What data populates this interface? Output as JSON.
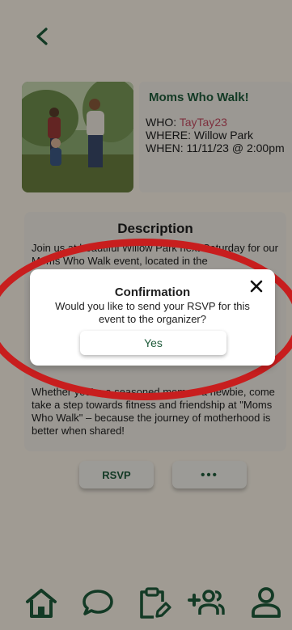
{
  "event": {
    "title": "Moms Who Walk!",
    "who_label": "WHO: ",
    "who_value": "TayTay23",
    "where": "WHERE: Willow Park",
    "when": "WHEN: 11/11/23 @ 2:00pm"
  },
  "description": {
    "title": "Description",
    "text_top": "Join us at beautiful Willow Park next Saturday for our Moms Who Walk event, located in the",
    "text_bottom": "Whether you're a seasoned mom or a newbie, come take a step towards fitness and friendship at \"Moms Who Walk\" – because the journey of motherhood is better when shared!"
  },
  "actions": {
    "rsvp_label": "RSVP",
    "more_label": "•••"
  },
  "modal": {
    "title": "Confirmation",
    "message": "Would you like to send your RSVP for this event to the organizer?",
    "confirm_label": "Yes",
    "close_icon": "close-icon"
  },
  "nav": {
    "items": [
      "home-icon",
      "chat-icon",
      "clipboard-edit-icon",
      "add-group-icon",
      "profile-icon"
    ]
  },
  "colors": {
    "brand_green": "#1f5b3a",
    "accent_pink": "#c64b62",
    "background": "#faf3e7",
    "annotation_red": "#c81e1e"
  }
}
